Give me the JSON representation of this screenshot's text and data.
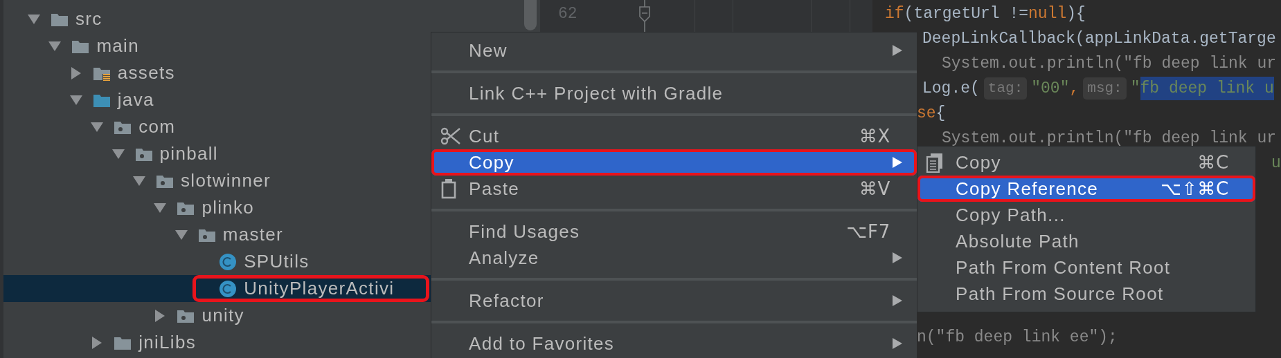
{
  "project_tree": {
    "items": [
      {
        "label": "src",
        "kind": "folder",
        "expanded": true,
        "selected": false,
        "children": [
          {
            "label": "main",
            "kind": "folder",
            "expanded": true,
            "selected": false,
            "children": [
              {
                "label": "assets",
                "kind": "resources",
                "expanded": false,
                "selected": false
              },
              {
                "label": "java",
                "kind": "source-root",
                "expanded": true,
                "selected": false,
                "children": [
                  {
                    "label": "com",
                    "kind": "package",
                    "expanded": true,
                    "selected": false,
                    "children": [
                      {
                        "label": "pinball",
                        "kind": "package",
                        "expanded": true,
                        "selected": false,
                        "children": [
                          {
                            "label": "slotwinner",
                            "kind": "package",
                            "expanded": true,
                            "selected": false,
                            "children": [
                              {
                                "label": "plinko",
                                "kind": "package",
                                "expanded": true,
                                "selected": false,
                                "children": [
                                  {
                                    "label": "master",
                                    "kind": "package",
                                    "expanded": true,
                                    "selected": false,
                                    "children": [
                                      {
                                        "label": "SPUtils",
                                        "kind": "class",
                                        "selected": false
                                      },
                                      {
                                        "label": "UnityPlayerActivi",
                                        "kind": "class",
                                        "selected": true
                                      }
                                    ]
                                  }
                                ]
                              },
                              {
                                "label": "unity",
                                "kind": "package",
                                "expanded": false,
                                "selected": false
                              }
                            ]
                          }
                        ]
                      }
                    ]
                  },
                  {
                    "label": "jniLibs",
                    "kind": "folder",
                    "expanded": false,
                    "selected": false
                  }
                ]
              }
            ]
          }
        ]
      }
    ]
  },
  "gutter": {
    "line_number": "62"
  },
  "code_lines": [
    {
      "segments": [
        {
          "text": "if",
          "kind": "keyword"
        },
        {
          "text": " (targetUrl != ",
          "kind": "plain"
        },
        {
          "text": "null",
          "kind": "keyword"
        },
        {
          "text": "){",
          "kind": "plain"
        }
      ]
    },
    {
      "segments": [
        {
          "text": "DeepLinkCallback(appLinkData.getTarge",
          "kind": "plain"
        }
      ]
    },
    {
      "segments": [
        {
          "text": "System.out.println(\"fb deep link ur",
          "kind": "dim"
        }
      ]
    },
    {
      "segments": [
        {
          "text": "Log.e(",
          "kind": "plain"
        },
        {
          "text": "tag:",
          "kind": "hint"
        },
        {
          "text": "\"00\"",
          "kind": "string"
        },
        {
          "text": ",",
          "kind": "keyword"
        },
        {
          "text": "msg:",
          "kind": "hint"
        },
        {
          "text": "\"",
          "kind": "string"
        },
        {
          "text": "fb deep link u",
          "kind": "string",
          "selected": true
        }
      ]
    },
    {
      "segments": [
        {
          "text": "se",
          "kind": "keyword"
        },
        {
          "text": "{",
          "kind": "plain"
        }
      ]
    },
    {
      "segments": [
        {
          "text": "System.out.println(\"fb deep link ur",
          "kind": "dim"
        }
      ]
    },
    {
      "segments": [
        {
          "text": "u",
          "kind": "string"
        }
      ]
    },
    {
      "segments": [
        {
          "text": "n(\"fb deep link ee\");",
          "kind": "dim"
        }
      ]
    }
  ],
  "context_menu": {
    "items": [
      {
        "kind": "item",
        "label": "New",
        "submenu": true,
        "selected": false
      },
      {
        "kind": "separator"
      },
      {
        "kind": "item",
        "label": "Link C++ Project with Gradle",
        "submenu": false,
        "selected": false
      },
      {
        "kind": "separator"
      },
      {
        "kind": "cut",
        "label": "Cut",
        "shortcut": "⌘X",
        "submenu": false,
        "selected": false
      },
      {
        "kind": "item",
        "label": "Copy",
        "submenu": true,
        "selected": true
      },
      {
        "kind": "paste",
        "label": "Paste",
        "shortcut": "⌘V",
        "submenu": false,
        "selected": false
      },
      {
        "kind": "separator"
      },
      {
        "kind": "item",
        "label": "Find Usages",
        "shortcut": "⌥F7",
        "submenu": false,
        "selected": false
      },
      {
        "kind": "item",
        "label": "Analyze",
        "submenu": true,
        "selected": false
      },
      {
        "kind": "separator"
      },
      {
        "kind": "item",
        "label": "Refactor",
        "submenu": true,
        "selected": false
      },
      {
        "kind": "separator"
      },
      {
        "kind": "item",
        "label": "Add to Favorites",
        "submenu": true,
        "selected": false
      }
    ]
  },
  "copy_submenu": {
    "items": [
      {
        "kind": "copy",
        "label": "Copy",
        "shortcut": "⌘C",
        "selected": false
      },
      {
        "kind": "item",
        "label": "Copy Reference",
        "shortcut": "⌥⇧⌘C",
        "selected": true
      },
      {
        "kind": "item",
        "label": "Copy Path...",
        "selected": false
      },
      {
        "kind": "item",
        "label": "Absolute Path",
        "selected": false
      },
      {
        "kind": "item",
        "label": "Path From Content Root",
        "selected": false
      },
      {
        "kind": "item",
        "label": "Path From Source Root",
        "selected": false
      }
    ]
  },
  "highlight_boxes": [
    {
      "kind": "tree-item"
    },
    {
      "kind": "menu-item"
    },
    {
      "kind": "submenu-item"
    }
  ]
}
